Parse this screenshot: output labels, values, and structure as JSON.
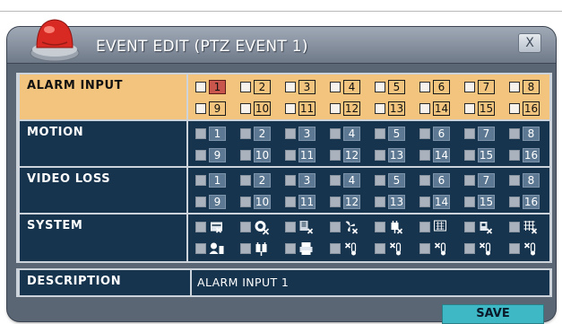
{
  "window": {
    "title": "EVENT EDIT (PTZ EVENT 1)",
    "close_label": "X"
  },
  "rows": [
    {
      "label": "ALARM INPUT",
      "selected": true,
      "checked": [],
      "numbers": [
        "1",
        "2",
        "3",
        "4",
        "5",
        "6",
        "7",
        "8",
        "9",
        "10",
        "11",
        "12",
        "13",
        "14",
        "15",
        "16"
      ]
    },
    {
      "label": "MOTION",
      "selected": false,
      "checked": [],
      "numbers": [
        "1",
        "2",
        "3",
        "4",
        "5",
        "6",
        "7",
        "8",
        "9",
        "10",
        "11",
        "12",
        "13",
        "14",
        "15",
        "16"
      ]
    },
    {
      "label": "VIDEO LOSS",
      "selected": false,
      "checked": [],
      "numbers": [
        "1",
        "2",
        "3",
        "4",
        "5",
        "6",
        "7",
        "8",
        "9",
        "10",
        "11",
        "12",
        "13",
        "14",
        "15",
        "16"
      ]
    },
    {
      "label": "SYSTEM",
      "selected": false,
      "checked": [],
      "icons": [
        "hdd-full-icon",
        "camera-error-icon",
        "disk-error-icon",
        "fan-error-icon",
        "power-error-icon",
        "board-error-icon",
        "network-error-icon",
        "grid-error-icon",
        "login-fail-icon",
        "power-on-icon",
        "printer-icon",
        "temperature-icon",
        "temperature-icon",
        "temperature-icon",
        "temperature-icon",
        "temperature-icon"
      ]
    }
  ],
  "focused_item": "1",
  "description": {
    "label": "DESCRIPTION",
    "value": "ALARM INPUT 1"
  },
  "buttons": {
    "save": "SAVE"
  },
  "colors": {
    "selected_row": "#f2c47d",
    "normal_row": "#17344f",
    "focus": "#c9564d",
    "save_button": "#3db8c4"
  }
}
